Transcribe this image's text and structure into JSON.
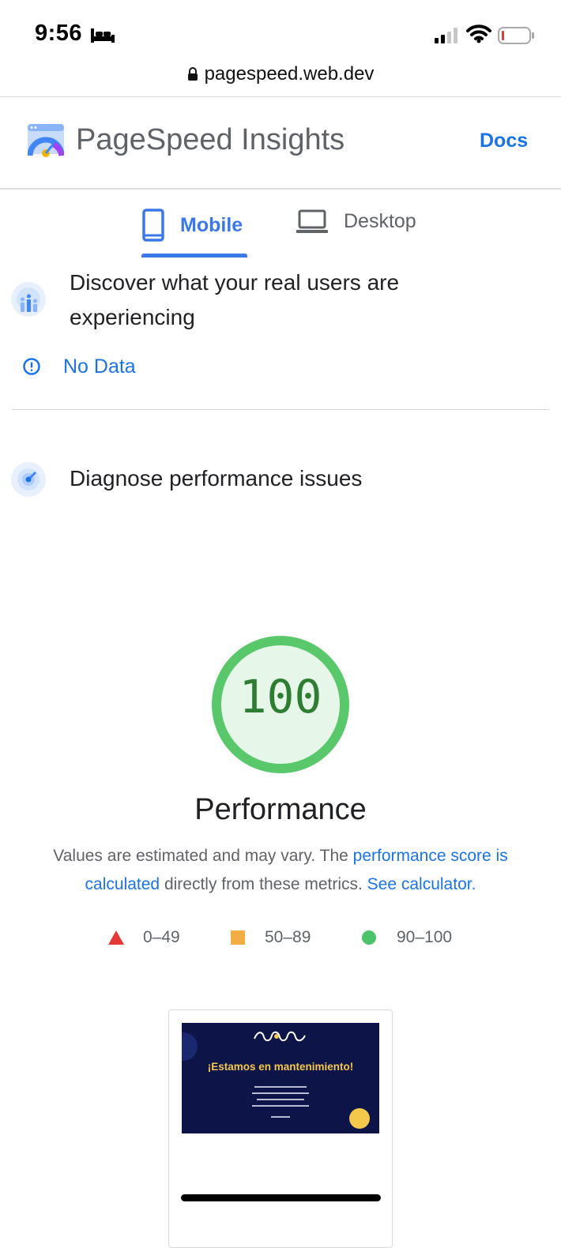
{
  "status_bar": {
    "time": "9:56"
  },
  "browser": {
    "url": "pagespeed.web.dev"
  },
  "header": {
    "title": "PageSpeed Insights",
    "docs_label": "Docs"
  },
  "tabs": [
    {
      "label": "Mobile",
      "active": true
    },
    {
      "label": "Desktop",
      "active": false
    }
  ],
  "field_data": {
    "title": "Discover what your real users are experiencing",
    "status": "No Data"
  },
  "lab_data": {
    "title": "Diagnose performance issues"
  },
  "performance": {
    "score": "100",
    "title": "Performance",
    "desc_prefix": "Values are estimated and may vary. The ",
    "desc_link1": "performance score is calculated",
    "desc_middle": " directly from these metrics. ",
    "desc_link2": "See calculator.",
    "legend": [
      "0–49",
      "50–89",
      "90–100"
    ]
  },
  "thumbnail": {
    "heading": "¡Estamos en mantenimiento!"
  },
  "colors": {
    "accent": "#1a73e8",
    "pass": "#0cce6b",
    "average": "#ffa400",
    "fail": "#ff4e42"
  }
}
